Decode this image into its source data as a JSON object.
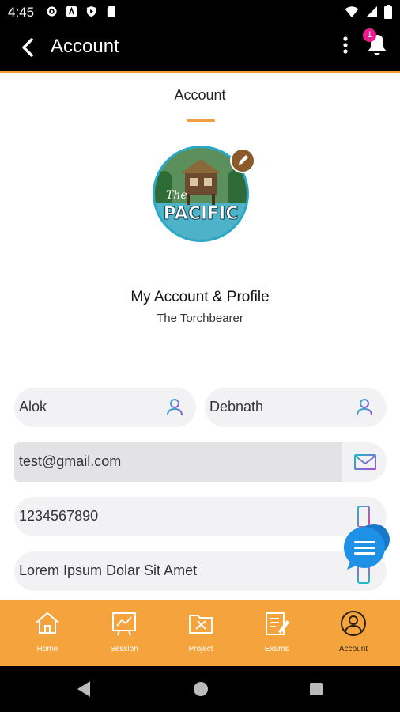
{
  "status_bar": {
    "time": "4:45"
  },
  "app_bar": {
    "title": "Account",
    "notification_count": "1"
  },
  "page": {
    "title": "Account",
    "profile_heading": "My Account & Profile",
    "profile_subtitle": "The Torchbearer"
  },
  "form": {
    "first_name": "Alok",
    "last_name": "Debnath",
    "email": "test@gmail.com",
    "phone": "1234567890",
    "address": "Lorem Ipsum Dolar Sit Amet"
  },
  "bottom_nav": {
    "items": [
      {
        "label": "Home",
        "icon": "home-icon"
      },
      {
        "label": "Session",
        "icon": "session-icon"
      },
      {
        "label": "Project",
        "icon": "project-icon"
      },
      {
        "label": "Exams",
        "icon": "exams-icon"
      },
      {
        "label": "Account",
        "icon": "account-icon"
      }
    ],
    "active": "Account"
  },
  "colors": {
    "accent": "#f5a43d",
    "badge": "#e91e8c",
    "icon_gradient": "#a64bd6"
  }
}
